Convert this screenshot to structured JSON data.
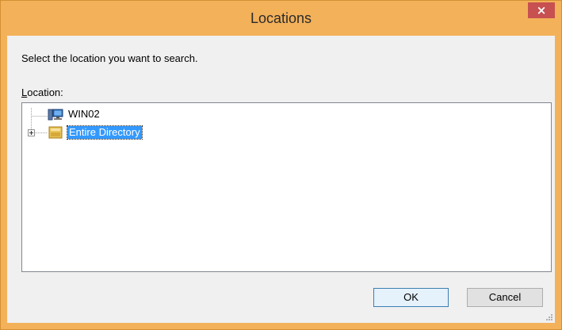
{
  "window": {
    "title": "Locations",
    "close_glyph": "×"
  },
  "dialog": {
    "prompt": "Select the location you want to search.",
    "location_label_accel": "L",
    "location_label_rest": "ocation:"
  },
  "tree": {
    "nodes": [
      {
        "label": "WIN02",
        "icon": "computer-icon",
        "selected": false,
        "expandable": false
      },
      {
        "label": "Entire Directory",
        "icon": "directory-icon",
        "selected": true,
        "expandable": true
      }
    ]
  },
  "buttons": {
    "ok_label": "OK",
    "cancel_label": "Cancel"
  },
  "colors": {
    "frame": "#f3b15a",
    "close_button": "#c75050",
    "selection": "#3399ff"
  }
}
